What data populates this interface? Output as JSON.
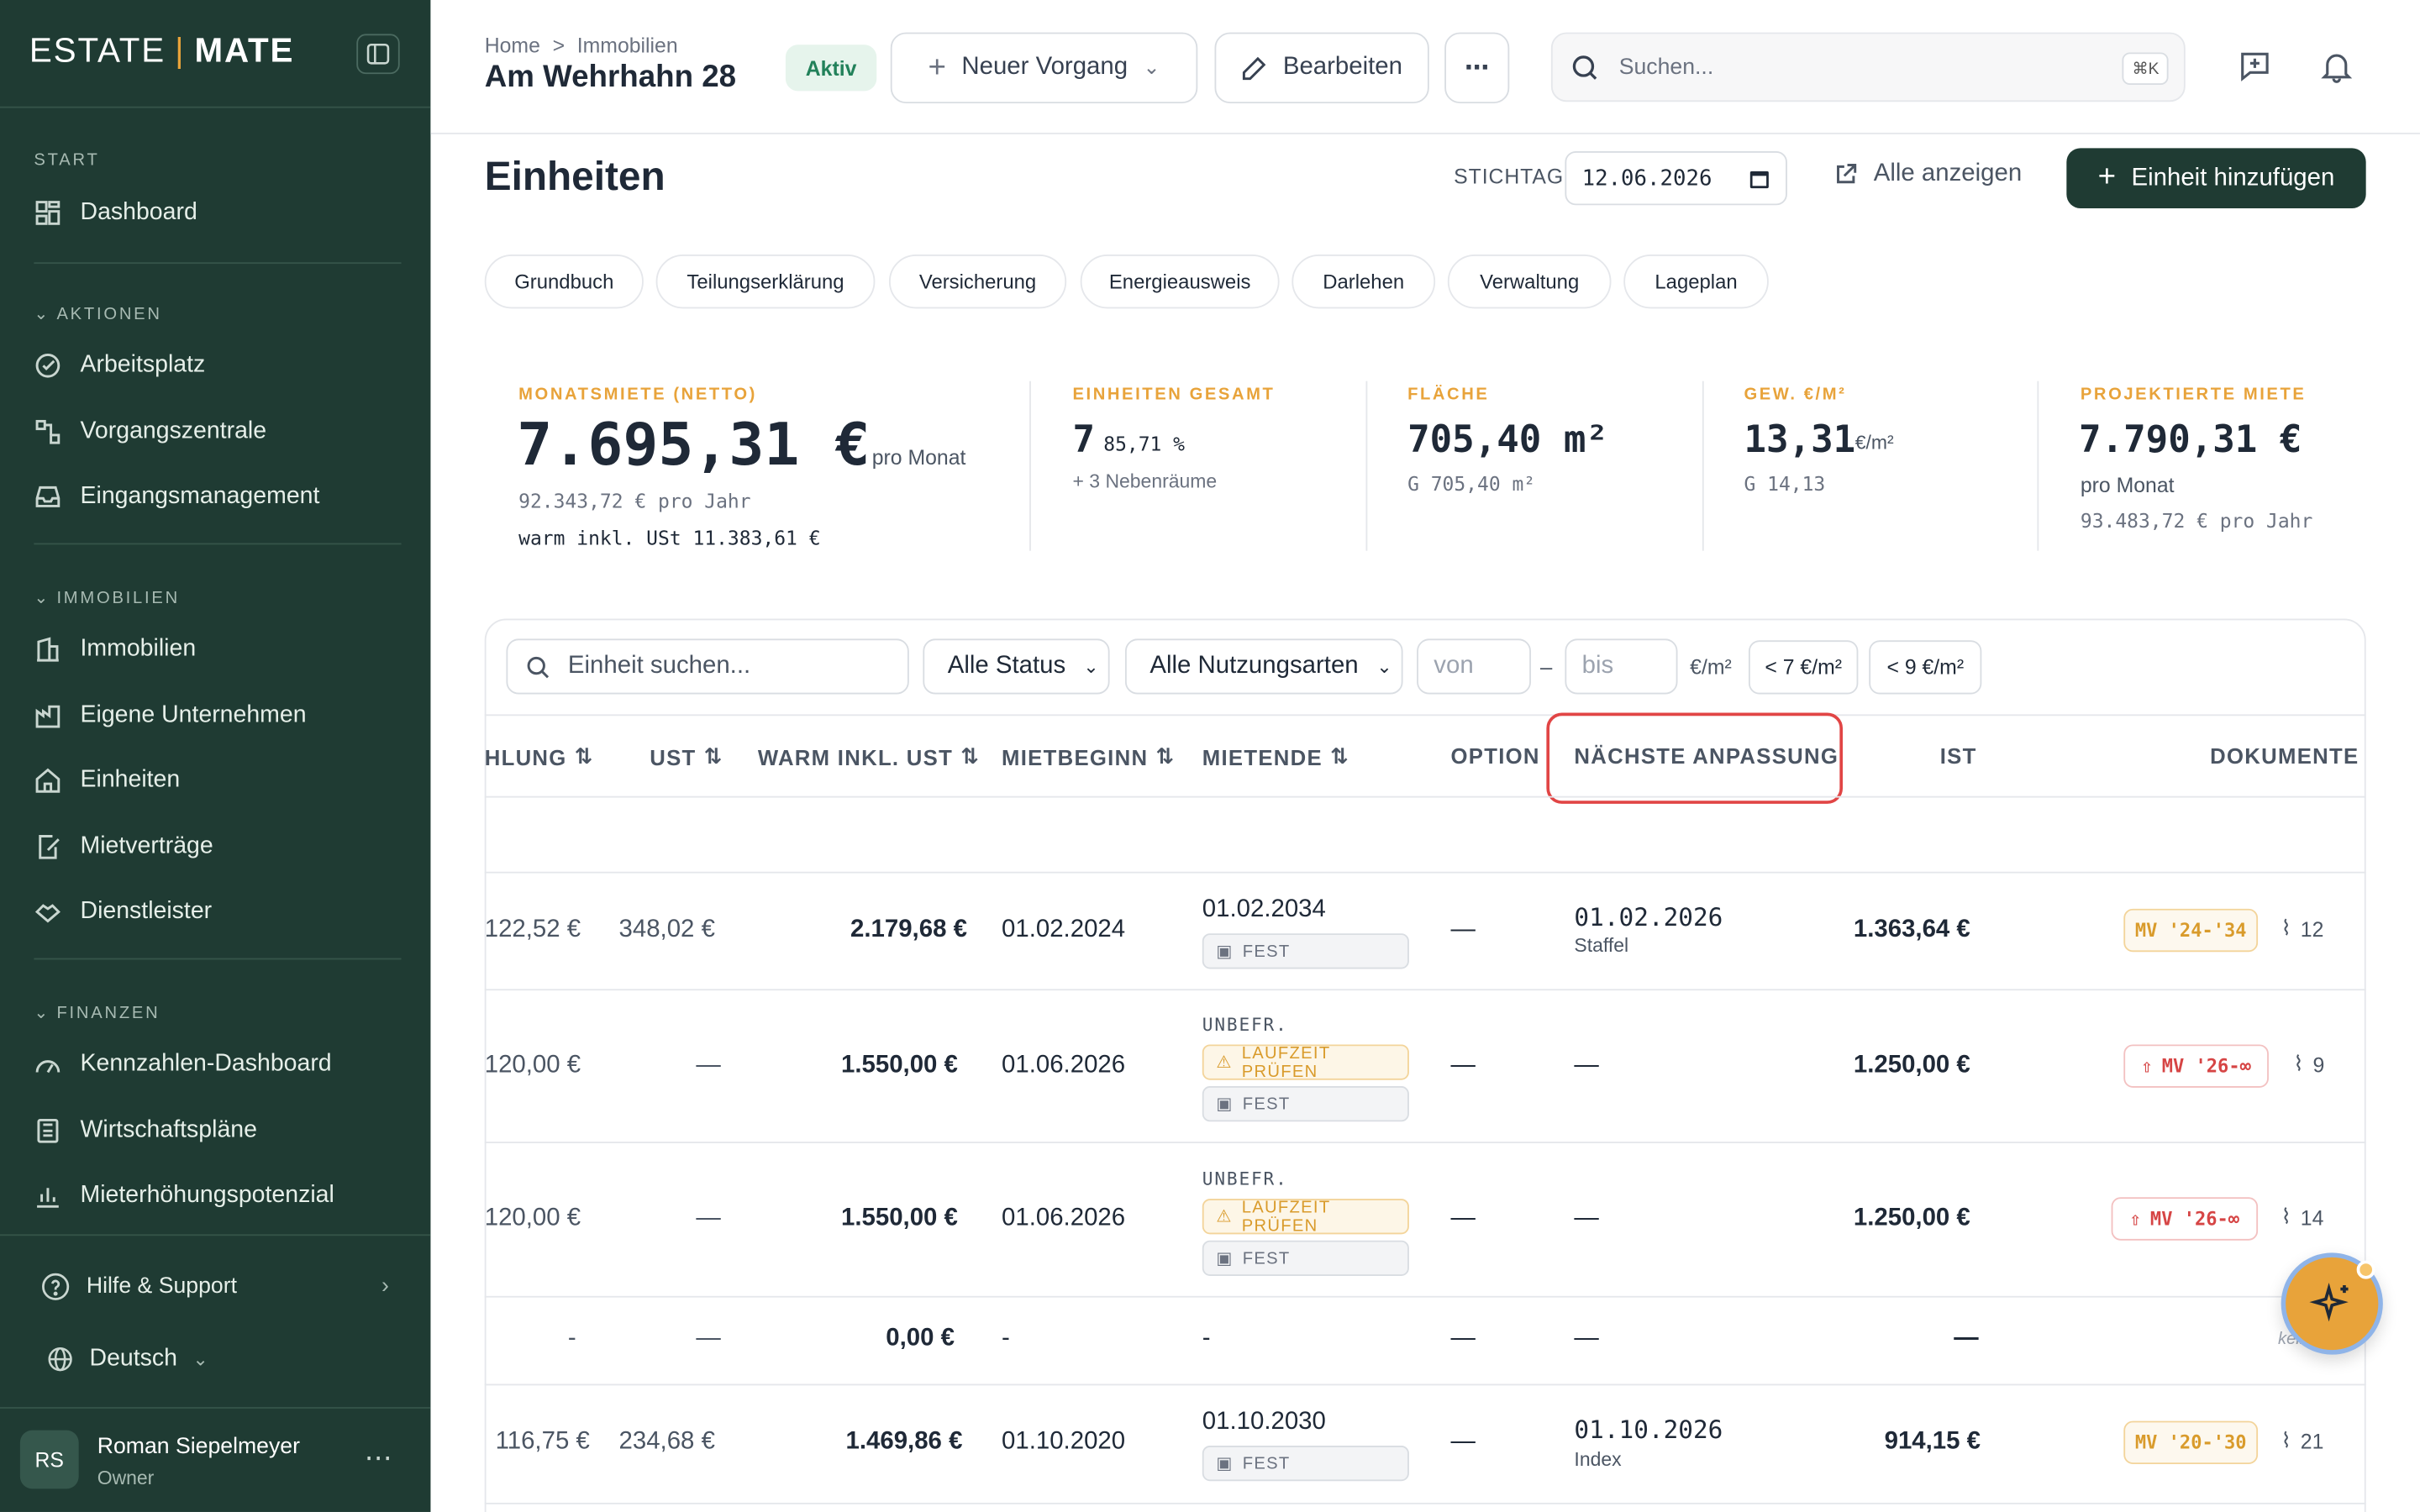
{
  "brand": {
    "left": "ESTATE",
    "sep": "|",
    "right": "MATE"
  },
  "sidebar": {
    "sec_start": "START",
    "dashboard": "Dashboard",
    "sec_aktionen": "AKTIONEN",
    "arbeitsplatz": "Arbeitsplatz",
    "vorgangszentrale": "Vorgangszentrale",
    "eingang": "Eingangsmanagement",
    "sec_immobilien": "IMMOBILIEN",
    "immobilien": "Immobilien",
    "unternehmen": "Eigene Unternehmen",
    "einheiten": "Einheiten",
    "mietvertraege": "Mietverträge",
    "dienstleister": "Dienstleister",
    "sec_finanzen": "FINANZEN",
    "kennzahlen": "Kennzahlen-Dashboard",
    "wirtschaft": "Wirtschaftspläne",
    "mieterhoehung": "Mieterhöhungspotenzial",
    "help": "Hilfe & Support",
    "language": "Deutsch",
    "user": {
      "initials": "RS",
      "name": "Roman Siepelmeyer",
      "role": "Owner",
      "more": "⋯"
    }
  },
  "header": {
    "crumb_home": "Home",
    "crumb_sep": ">",
    "crumb_immo": "Immobilien",
    "title": "Am Wehrhahn 28",
    "status": "Aktiv",
    "neuer_vorgang": "Neuer Vorgang",
    "bearbeiten": "Bearbeiten",
    "more": "⋯",
    "search_placeholder": "Suchen...",
    "shortcut": "⌘K"
  },
  "main": {
    "title": "Einheiten",
    "stichtag_label": "STICHTAG",
    "stichtag_value": "12.06.2026",
    "alle_anzeigen": "Alle anzeigen",
    "add_unit": "Einheit hinzufügen",
    "chips": [
      "Grundbuch",
      "Teilungserklärung",
      "Versicherung",
      "Energieausweis",
      "Darlehen",
      "Verwaltung",
      "Lageplan"
    ]
  },
  "kpis": {
    "miete": {
      "label": "MONATSMIETE (NETTO)",
      "value": "7.695,31 €",
      "unit": "pro Monat",
      "year": "92.343,72 € pro Jahr",
      "warm": "warm inkl. USt 11.383,61 €"
    },
    "einheiten": {
      "label": "EINHEITEN GESAMT",
      "value": "7",
      "pct": "85,71 %",
      "sub": "+ 3 Nebenräume"
    },
    "flaeche": {
      "label": "FLÄCHE",
      "value": "705,40 m²",
      "sub": "G 705,40 m²"
    },
    "gew": {
      "label": "GEW. €/M²",
      "value": "13,31",
      "unit": "€/m²",
      "sub": "G 14,13"
    },
    "proj": {
      "label": "PROJEKTIERTE MIETE",
      "value": "7.790,31 €",
      "unit": "pro Monat",
      "year": "93.483,72 € pro Jahr"
    }
  },
  "filters": {
    "search_placeholder": "Einheit suchen...",
    "status": "Alle Status",
    "nutzung": "Alle Nutzungsarten",
    "von": "von",
    "dash": "–",
    "bis": "bis",
    "unit": "€/m²",
    "lt7": "< 7 €/m²",
    "lt9": "< 9 €/m²"
  },
  "table": {
    "headers": {
      "zahlung": "HLUNG",
      "ust": "UST",
      "warm": "WARM INKL. UST",
      "mietbeginn": "MIETBEGINN",
      "mietende": "MIETENDE",
      "option": "OPTION",
      "anpassung": "NÄCHSTE ANPASSUNG",
      "ist": "IST",
      "dokumente": "DOKUMENTE"
    },
    "sort_icon": "⇅",
    "fest": "FEST",
    "unbefristet": "UNBEFR.",
    "laufzeit": "LAUFZEIT PRÜFEN",
    "rows": [
      {
        "zahlung": "122,52 €",
        "ust": "348,02 €",
        "warm": "2.179,68 €",
        "beginn": "01.02.2024",
        "ende": "01.02.2034",
        "option": "—",
        "anpassung": "01.02.2026",
        "anpassung_sub": "Staffel",
        "ist": "1.363,64 €",
        "doc": "MV '24-'34",
        "att": "12"
      },
      {
        "zahlung": "120,00 €",
        "ust": "—",
        "warm": "1.550,00 €",
        "beginn": "01.06.2026",
        "ende": "",
        "option": "—",
        "anpassung": "—",
        "anpassung_sub": "",
        "ist": "1.250,00 €",
        "doc": "MV '26-∞",
        "att": "9"
      },
      {
        "zahlung": "120,00 €",
        "ust": "—",
        "warm": "1.550,00 €",
        "beginn": "01.06.2026",
        "ende": "",
        "option": "—",
        "anpassung": "—",
        "anpassung_sub": "",
        "ist": "1.250,00 €",
        "doc": "MV '26-∞",
        "att": "14"
      },
      {
        "zahlung": "-",
        "ust": "—",
        "warm": "0,00 €",
        "beginn": "-",
        "ende": "-",
        "option": "—",
        "anpassung": "—",
        "anpassung_sub": "",
        "ist": "—",
        "doc": "kein",
        "att": ""
      },
      {
        "zahlung": "116,75 €",
        "ust": "234,68 €",
        "warm": "1.469,86 €",
        "beginn": "01.10.2020",
        "ende": "01.10.2030",
        "option": "—",
        "anpassung": "01.10.2026",
        "anpassung_sub": "Index",
        "ist": "914,15 €",
        "doc": "MV '20-'30",
        "att": "21"
      }
    ]
  },
  "colors": {
    "sidebar": "#1f3b33",
    "accent": "#e8a33a",
    "primary": "#1f3b33",
    "highlight": "#e14545"
  }
}
